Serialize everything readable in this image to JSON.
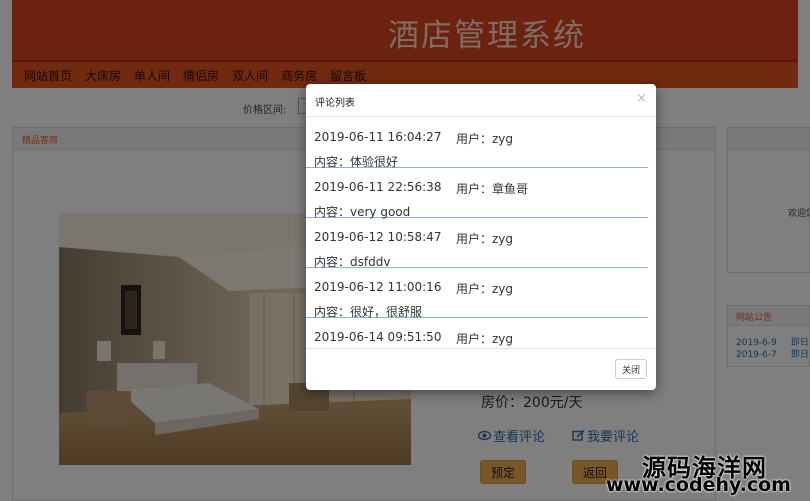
{
  "site": {
    "title": "酒店管理系统"
  },
  "nav": [
    "网站首页",
    "大床房",
    "单人间",
    "情侣房",
    "双人间",
    "商务房",
    "留言板"
  ],
  "filter": {
    "label": "价格区间:"
  },
  "featured": {
    "heading": "精品客房"
  },
  "room": {
    "price": "房价：200元/天",
    "view_comments": "查看评论",
    "write_comment": "我要评论",
    "book": "预定",
    "back": "返回"
  },
  "sidebar": {
    "welcome": "欢迎您",
    "notice_title": "网站公告",
    "notices": [
      {
        "date": "2019-6-9",
        "text": "即日起"
      },
      {
        "date": "2019-6-7",
        "text": "即日起"
      }
    ]
  },
  "modal": {
    "title": "评论列表",
    "close_glyph": "×",
    "close_button": "关闭",
    "comments": [
      {
        "time": "2019-06-11 16:04:27",
        "user": "用户：zyg",
        "content": "内容：体验很好"
      },
      {
        "time": "2019-06-11 22:56:38",
        "user": "用户：章鱼哥",
        "content": "内容：very good"
      },
      {
        "time": "2019-06-12 10:58:47",
        "user": "用户：zyg",
        "content": "内容：dsfddv"
      },
      {
        "time": "2019-06-12 11:00:16",
        "user": "用户：zyg",
        "content": "内容：很好，很舒服"
      },
      {
        "time": "2019-06-14 09:51:50",
        "user": "用户：zyg",
        "content": ""
      }
    ]
  },
  "watermark": {
    "name": "源码海洋网",
    "url": "www.codehy.com"
  },
  "colors": {
    "header": "#d9451e",
    "nav": "#e2541f",
    "link": "#2a6fb0",
    "button": "#f0ad4e"
  }
}
